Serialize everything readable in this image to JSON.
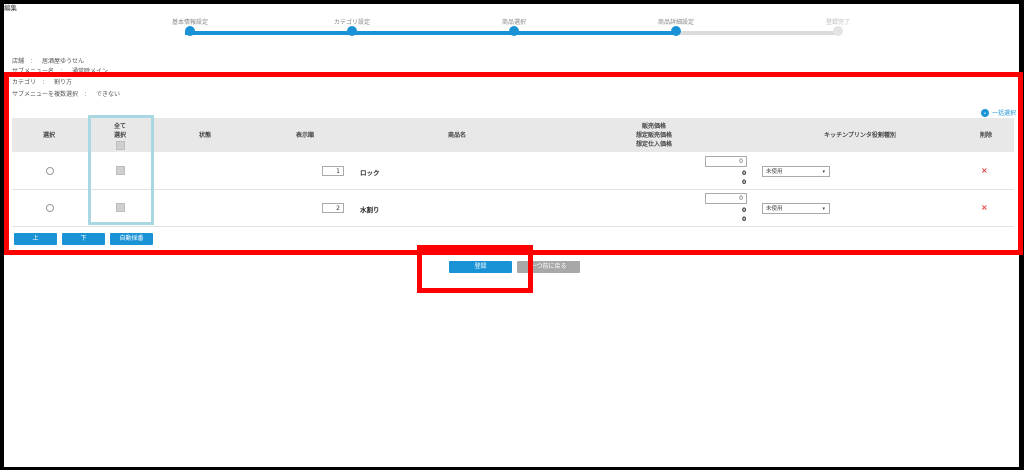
{
  "page_title": "編集",
  "steps": [
    {
      "label": "基本情報設定",
      "state": "done"
    },
    {
      "label": "カテゴリ設定",
      "state": "done"
    },
    {
      "label": "商品選択",
      "state": "done"
    },
    {
      "label": "商品詳細設定",
      "state": "current"
    },
    {
      "label": "登録完了",
      "state": "todo"
    }
  ],
  "info": {
    "shop_label": "店舗",
    "shop_value": "居酒屋ゆうせん",
    "hidden_label": "サブメニュー名",
    "hidden_value": "通常時メイン",
    "category_label": "カテゴリ",
    "category_value": "割り方",
    "submenu_multi_label": "サブメニューを複数選択",
    "submenu_multi_value": "できない",
    "separator": "："
  },
  "bulk_select_label": "一括選択",
  "table": {
    "headers": {
      "select": "選択",
      "select_all_line1": "全て",
      "select_all_line2": "選択",
      "status": "状態",
      "order": "表示順",
      "product_name": "商品名",
      "price_line1": "販売価格",
      "price_line2": "想定販売価格",
      "price_line3": "想定仕入価格",
      "kitchen_printer": "キッチンプリンタ役割種別",
      "delete": "削除"
    },
    "rows": [
      {
        "order": "1",
        "name": "ロック",
        "price_input": "0",
        "price_est_sale": "0",
        "price_est_cost": "0",
        "printer": "未使用"
      },
      {
        "order": "2",
        "name": "水割り",
        "price_input": "0",
        "price_est_sale": "0",
        "price_est_cost": "0",
        "printer": "未使用"
      }
    ],
    "delete_symbol": "×"
  },
  "buttons": {
    "up": "上",
    "down": "下",
    "auto_sort": "自動採番",
    "register": "登録",
    "back": "一つ前に戻る"
  },
  "colors": {
    "accent": "#1a93d6",
    "highlight": "#ff0000",
    "delete": "#e23b3b"
  }
}
